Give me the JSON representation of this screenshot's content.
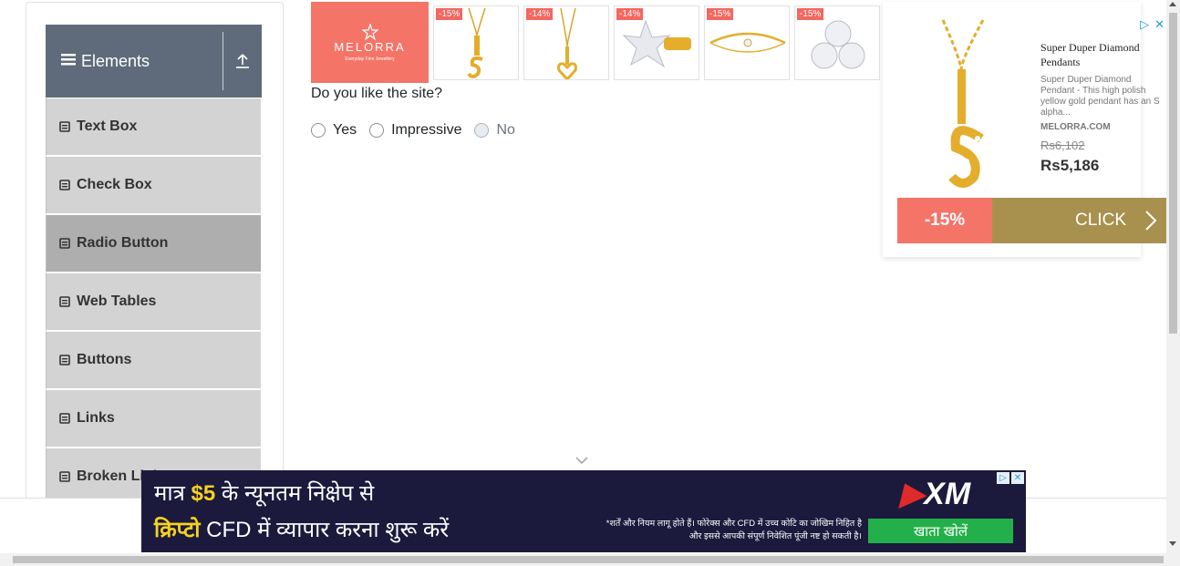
{
  "sidebar": {
    "group_title": "Elements",
    "items": [
      {
        "label": "Text Box"
      },
      {
        "label": "Check Box"
      },
      {
        "label": "Radio Button"
      },
      {
        "label": "Web Tables"
      },
      {
        "label": "Buttons"
      },
      {
        "label": "Links"
      },
      {
        "label": "Broken Links"
      }
    ],
    "active_item": "Radio Button"
  },
  "ad_strip": {
    "brand": "MELORRA",
    "brand_tagline": "Everyday Fine Jewellery",
    "products": [
      {
        "discount": "-15%",
        "icon": "pendant-s-icon"
      },
      {
        "discount": "-14%",
        "icon": "heart-pendant-icon"
      },
      {
        "discount": "-14%",
        "icon": "star-earring-icon"
      },
      {
        "discount": "-15%",
        "icon": "bracelet-icon"
      },
      {
        "discount": "-15%",
        "icon": "cluster-ring-icon"
      }
    ]
  },
  "main": {
    "question": "Do you like the site?",
    "options": [
      {
        "label": "Yes",
        "disabled": false
      },
      {
        "label": "Impressive",
        "disabled": false
      },
      {
        "label": "No",
        "disabled": true
      }
    ]
  },
  "side_ad": {
    "title": "Super Duper Diamond Pendants",
    "description": "Super Duper Diamond Pendant - This high polish yellow gold pendant has an S alpha...",
    "shop": "MELORRA.COM",
    "old_price": "Rs6,102",
    "new_price": "Rs5,186",
    "discount": "-15%",
    "cta": "CLICK"
  },
  "banner": {
    "line1_prefix": "मात्र ",
    "line1_amount": "$5",
    "line1_suffix": " के न्यूनतम निक्षेप से",
    "line2_highlight": "क्रिप्टो",
    "line2_rest": " CFD में व्यापार करना शुरू करें",
    "logo": "XM",
    "disclaimer": "*शर्तें और नियम लागू होते हैं। फोरेक्स और CFD में उच्च कोटि का जोखिम निहित है और इससे आपकी संपूर्ण निवेशित पूंजी नष्ट हो सकती है।",
    "button": "खाता खोलें"
  },
  "colors": {
    "header_bg": "#5f6b7a",
    "menu_bg": "#d3d3d3",
    "menu_active_bg": "#aeaeae",
    "brand_coral": "#f47468",
    "cta_gold": "#a8914e",
    "banner_bg": "#1b1a3d",
    "banner_button": "#23b04a"
  }
}
